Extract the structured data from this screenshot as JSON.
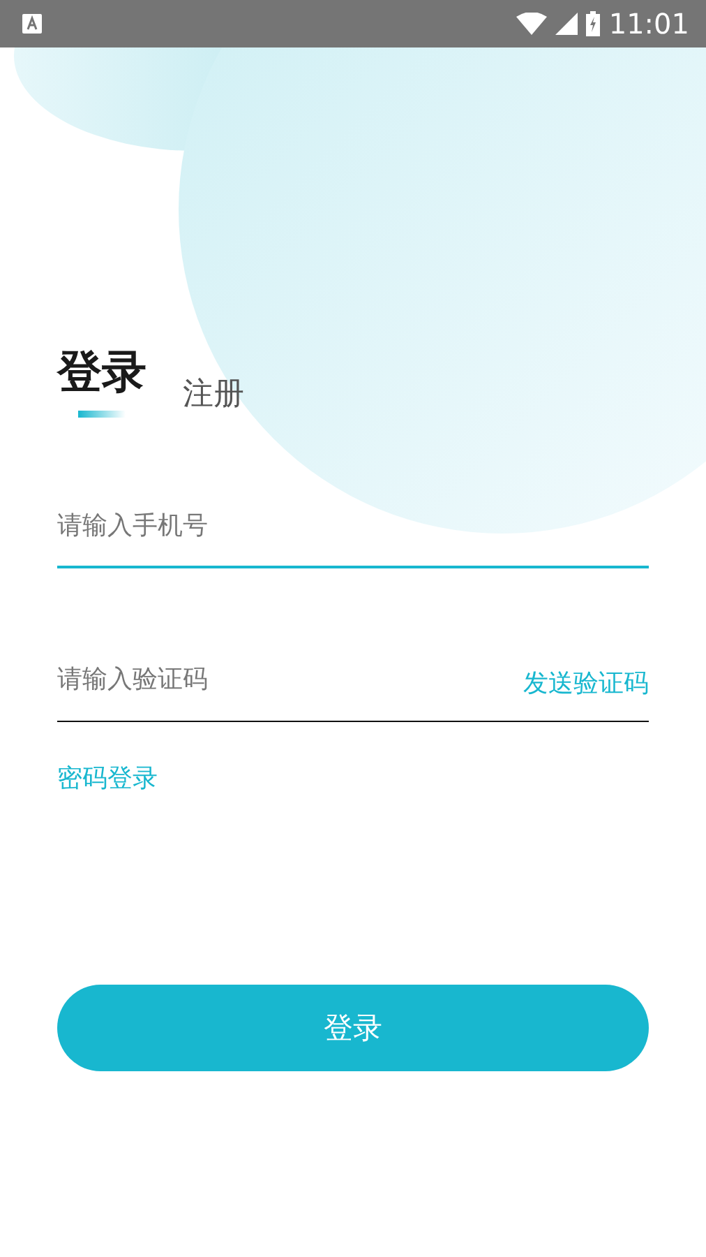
{
  "status_bar": {
    "time": "11:01"
  },
  "tabs": [
    {
      "label": "登录",
      "selected": true
    },
    {
      "label": "注册",
      "selected": false
    }
  ],
  "fields": [
    {
      "placeholder": "请输入手机号",
      "focused": true
    },
    {
      "placeholder": "请输入验证码",
      "focused": false,
      "action": "发送验证码"
    }
  ],
  "password_login_link": "密码登录",
  "login_button": "登录"
}
